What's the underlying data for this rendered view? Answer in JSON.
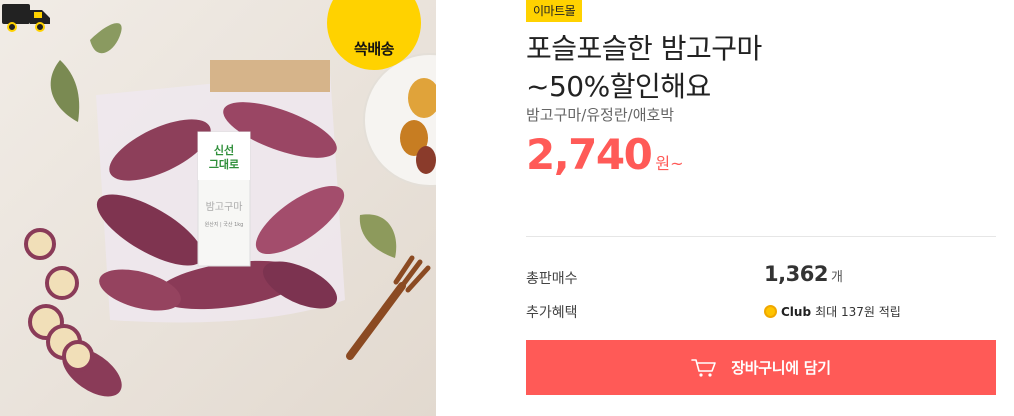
{
  "product_image": {
    "delivery_badge_label": "쓱배송",
    "package_brand": "신선\n그대로",
    "package_label": "밤고구마",
    "package_origin": "원산지 | 국산  1kg"
  },
  "store_badge": "이마트몰",
  "title_line1": "포슬포슬한 밤고구마",
  "title_line2": "~50%할인해요",
  "subtitle": "밤고구마/유정란/애호박",
  "price": {
    "value": "2,740",
    "unit": "원~"
  },
  "details": {
    "sold_label": "총판매수",
    "sold_number": "1,362",
    "sold_unit": "개",
    "benefit_label": "추가혜택",
    "club_name": "Club",
    "benefit_text": "최대 137원 적립"
  },
  "cart_button_label": "장바구니에 담기",
  "colors": {
    "accent": "#ff5a57",
    "badge_yellow": "#ffd200"
  }
}
